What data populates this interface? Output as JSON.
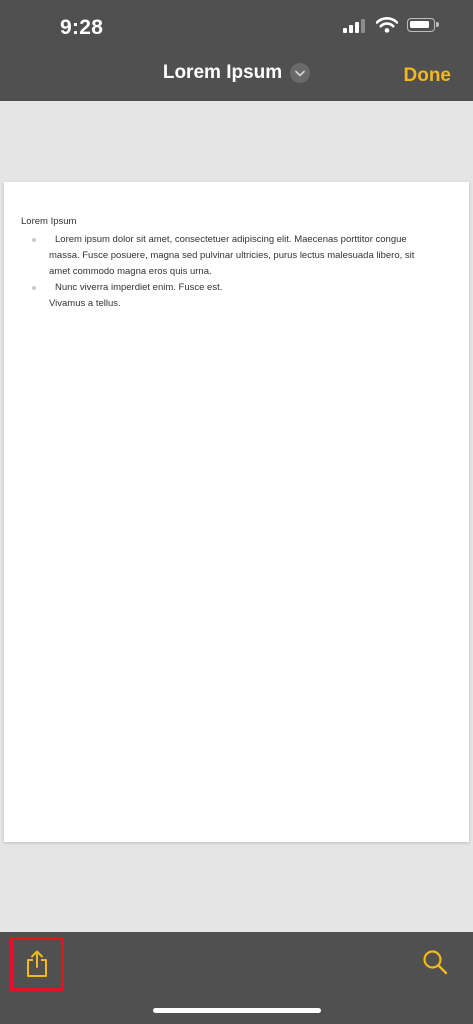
{
  "status_bar": {
    "time": "9:28",
    "signal_bars_filled": 3,
    "battery_level": 0.92
  },
  "nav": {
    "title": "Lorem Ipsum",
    "done_label": "Done",
    "accent_color": "#f2b81c"
  },
  "document": {
    "heading": "Lorem Ipsum",
    "bullets": [
      "Lorem ipsum dolor sit amet, consectetuer adipiscing elit. Maecenas porttitor congue massa. Fusce posuere, magna sed pulvinar ultricies, purus lectus malesuada libero, sit amet commodo magna eros quis urna.",
      "Nunc viverra imperdiet enim. Fusce est."
    ],
    "trailing_line": "Vivamus a tellus."
  },
  "toolbar": {
    "left_icon": "share-icon",
    "right_icon": "search-icon",
    "highlight_color": "#e3141f"
  }
}
